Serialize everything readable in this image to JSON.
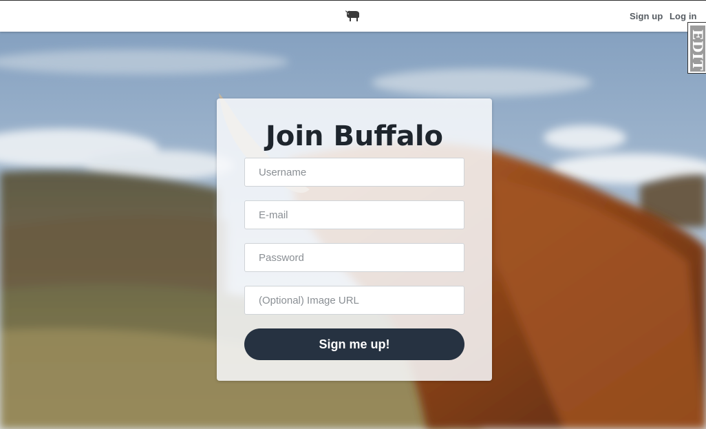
{
  "navbar": {
    "brand_icon": "buffalo-icon",
    "links": {
      "signup": "Sign up",
      "login": "Log in"
    }
  },
  "edit_tab": {
    "label": "EDIT"
  },
  "form": {
    "title": "Join Buffalo",
    "fields": {
      "username": {
        "placeholder": "Username",
        "value": ""
      },
      "email": {
        "placeholder": "E-mail",
        "value": ""
      },
      "password": {
        "placeholder": "Password",
        "value": ""
      },
      "image_url": {
        "placeholder": "(Optional) Image URL",
        "value": ""
      }
    },
    "submit_label": "Sign me up!"
  },
  "colors": {
    "navbar_bg": "#ffffff",
    "nav_link": "#555b61",
    "card_bg": "#f8f9fb",
    "button_bg": "#263241",
    "button_text": "#ffffff",
    "title_text": "#1e252d"
  }
}
